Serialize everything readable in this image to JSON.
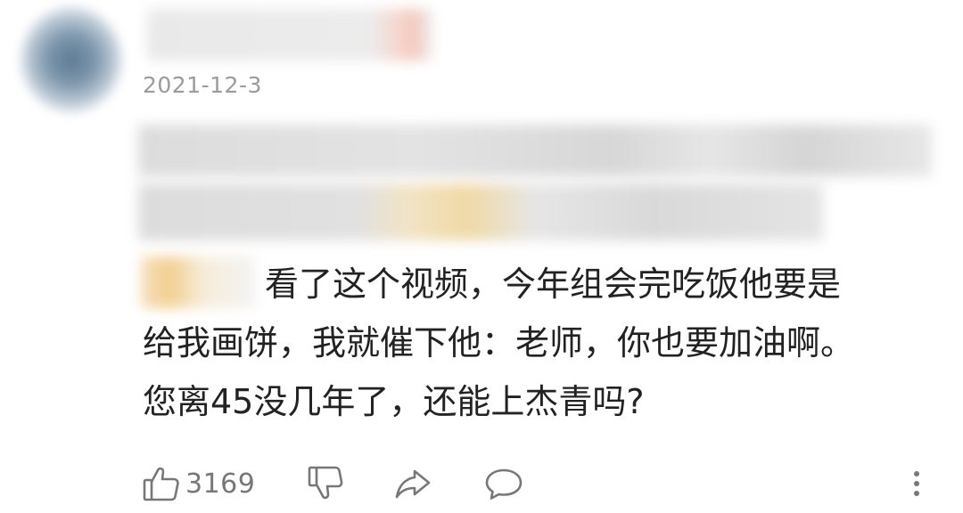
{
  "comment": {
    "date": "2021-12-3",
    "lines": [
      "看了这个视频，今年组会完吃饭他要是",
      "给我画饼，我就催下他：老师，你也要加油啊。",
      "您离45没几年了，还能上杰青吗?"
    ]
  },
  "actions": {
    "like_count": "3169",
    "like_icon": "thumbs-up-icon",
    "dislike_icon": "thumbs-down-icon",
    "share_icon": "share-arrow-icon",
    "reply_icon": "comment-bubble-icon",
    "more_icon": "more-vertical-icon"
  },
  "colors": {
    "text": "#222222",
    "muted": "#9b9b9b",
    "icon": "#777777"
  }
}
